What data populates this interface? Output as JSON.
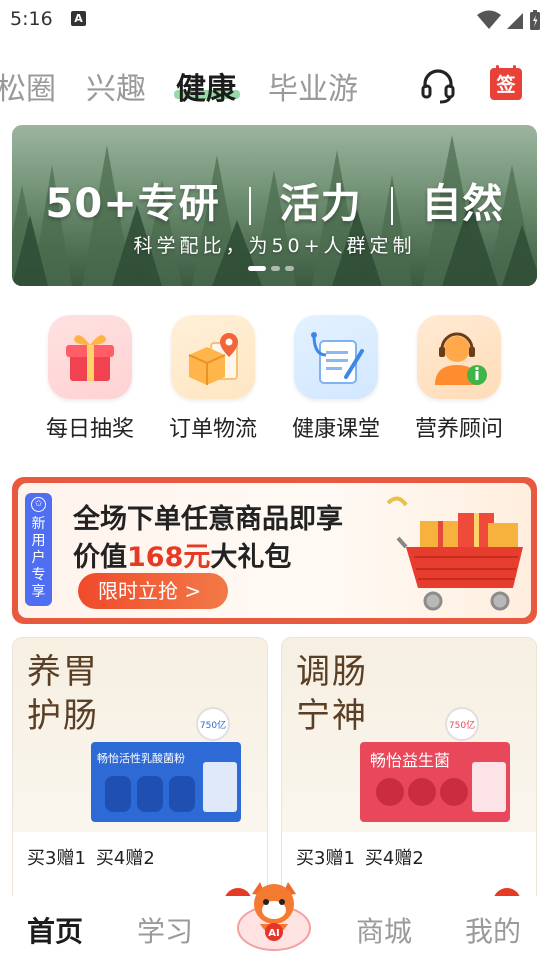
{
  "status_bar": {
    "time": "5:16",
    "notification_icon": "A"
  },
  "top_tabs": [
    {
      "label": "松圈",
      "active": false
    },
    {
      "label": "兴趣",
      "active": false
    },
    {
      "label": "健康",
      "active": true
    },
    {
      "label": "毕业游",
      "active": false
    }
  ],
  "header_icons": {
    "customer_service": "headset-icon",
    "sign_in": "签"
  },
  "banner": {
    "title_part1": "50+专研",
    "title_part2": "活力",
    "title_part3": "自然",
    "subtitle": "科学配比，为50+人群定制",
    "slide_count": 3,
    "active_slide": 1
  },
  "quick_actions": [
    {
      "label": "每日抽奖",
      "icon": "gift-box-icon"
    },
    {
      "label": "订单物流",
      "icon": "package-location-icon"
    },
    {
      "label": "健康课堂",
      "icon": "stethoscope-clipboard-icon"
    },
    {
      "label": "营养顾问",
      "icon": "advisor-headset-icon"
    }
  ],
  "promo": {
    "side_tag": [
      "新",
      "用",
      "户",
      "专",
      "享"
    ],
    "line1": "全场下单任意商品即享",
    "line2_prefix": "价值",
    "line2_highlight": "168元",
    "line2_suffix": "大礼包",
    "button": "限时立抢 >"
  },
  "products": [
    {
      "title_line1": "养胃",
      "title_line2": "护肠",
      "offers": [
        "买3赠1",
        "买4赠2"
      ],
      "pack_color": "#2d6ad6",
      "pack_text": "畅怡活性乳酸菌粉",
      "pack_badge": "750亿"
    },
    {
      "title_line1": "调肠",
      "title_line2": "宁神",
      "offers": [
        "买3赠1",
        "买4赠2"
      ],
      "pack_color": "#e8485a",
      "pack_text": "畅怡益生菌",
      "pack_badge": "750亿"
    }
  ],
  "bottom_nav": [
    {
      "label": "首页",
      "active": true
    },
    {
      "label": "学习",
      "active": false
    },
    {
      "label": "商城",
      "active": false
    },
    {
      "label": "我的",
      "active": false
    }
  ],
  "colors": {
    "accent_red": "#e53a24",
    "tab_underline": "#98d9a5",
    "promo_side": "#4f6ef2"
  }
}
